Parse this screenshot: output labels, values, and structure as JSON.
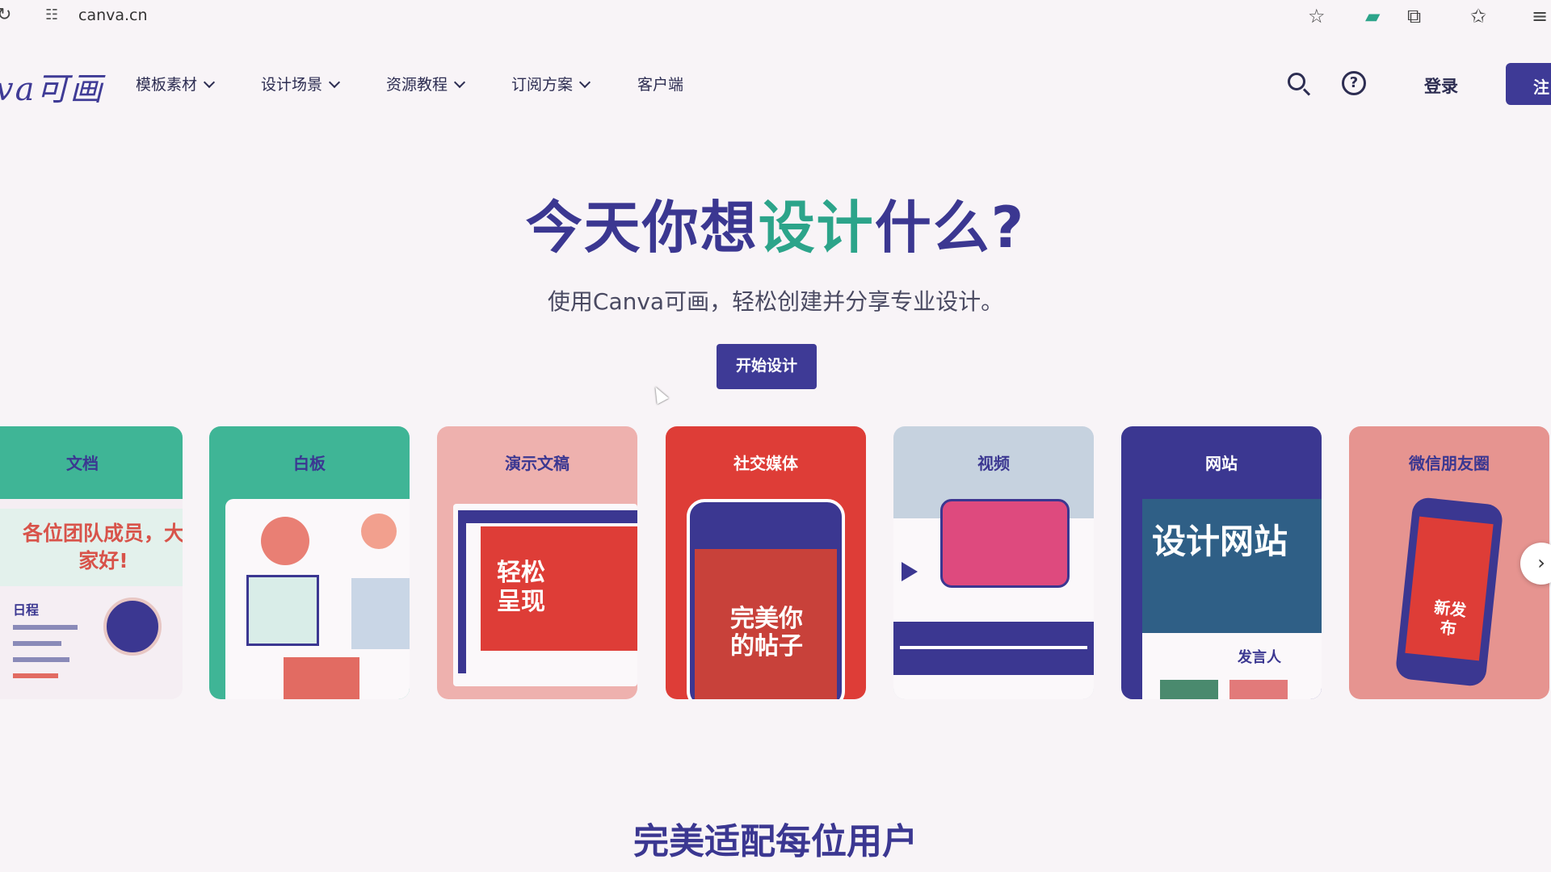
{
  "browser": {
    "url": "canva.cn"
  },
  "logo": {
    "text": "va可画"
  },
  "nav": [
    {
      "label": "模板素材",
      "has_dropdown": true
    },
    {
      "label": "设计场景",
      "has_dropdown": true
    },
    {
      "label": "资源教程",
      "has_dropdown": true
    },
    {
      "label": "订阅方案",
      "has_dropdown": true
    },
    {
      "label": "客户端",
      "has_dropdown": false
    }
  ],
  "header": {
    "login_label": "登录",
    "register_label": "注"
  },
  "hero": {
    "title_part1": "今天你想",
    "title_accent": "设计",
    "title_part2": "什么?",
    "subtitle": "使用Canva可画，轻松创建并分享专业设计。",
    "cta_label": "开始设计"
  },
  "cards": [
    {
      "title": "文档",
      "content_heading": "各位团队成员，大家好!",
      "content_sub": "日程"
    },
    {
      "title": "白板"
    },
    {
      "title": "演示文稿",
      "content_heading": "轻松呈现"
    },
    {
      "title": "社交媒体",
      "content_heading": "完美你的帖子"
    },
    {
      "title": "视频"
    },
    {
      "title": "网站",
      "content_heading": "设计网站",
      "content_sub": "发言人"
    },
    {
      "title": "微信朋友圈",
      "content_heading": "新发布"
    }
  ],
  "section": {
    "title": "完美适配每位用户"
  },
  "icons": [
    "reload-icon",
    "site-settings-icon",
    "bookmark-star-icon",
    "extension-icon",
    "puzzle-icon",
    "favorites-icon",
    "reading-list-icon",
    "search-icon",
    "help-icon",
    "chevron-right-icon"
  ]
}
